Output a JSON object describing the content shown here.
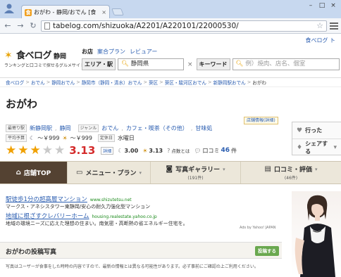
{
  "browser": {
    "tab_title": "おがわ - 静岡/おでん [食",
    "tab_close": "×",
    "url": "tabelog.com/shizuoka/A2201/A220101/22000530/",
    "window_buttons": [
      "–",
      "□",
      "×"
    ]
  },
  "header": {
    "top_right_link": "食べログ ト",
    "logo_text": "食べログ",
    "logo_region": "静岡",
    "tagline": "ランキングと口コミで探せるグルメサイト",
    "nav": [
      {
        "label": "お店",
        "active": true
      },
      {
        "label": "案合プラン",
        "active": false
      },
      {
        "label": "レビュアー",
        "active": false
      }
    ],
    "area_label": "エリア・駅",
    "area_value": "静岡県",
    "clear_icon": "×",
    "keyword_label": "キーワード",
    "keyword_placeholder": "例）焼肉、店名、個室"
  },
  "breadcrumb": {
    "items": [
      "食べログ",
      "おでん",
      "静岡おでん",
      "静岡市（静岡・清水）おでん",
      "葵区",
      "葵区・駿河区おでん",
      "新静岡駅おでん"
    ],
    "current": "おがわ"
  },
  "restaurant": {
    "name": "おがわ",
    "station_label": "最寄り駅",
    "stations": [
      "新静岡駅",
      "静岡"
    ],
    "genre_label": "ジャンル",
    "genres": [
      "おでん",
      "カフェ・喫茶（その他）",
      "甘味処"
    ],
    "info_badge": "店舗情報(詳細)",
    "price_label": "平均予算",
    "price_dinner": "～￥999",
    "price_lunch": "～￥999",
    "holiday_label": "定休日",
    "holiday": "水曜日",
    "rating": 3.13,
    "rating_stars": 3,
    "rating_text": "3.13",
    "detail_label": "詳細",
    "night_score": "3.00",
    "lunch_score": "3.13",
    "points_label": "点数とは",
    "review_label": "口コミ",
    "review_count": "46",
    "review_unit": "件"
  },
  "actions": {
    "went": "行った",
    "share": "シェアする"
  },
  "tabs": [
    {
      "label": "店舗TOP",
      "sub": "",
      "icon": "home-icon",
      "active": true
    },
    {
      "label": "メニュー・プラン",
      "sub": "",
      "icon": "book-icon",
      "active": false
    },
    {
      "label": "写真ギャラリー",
      "sub": "(191件)",
      "icon": "camera-icon",
      "active": false
    },
    {
      "label": "口コミ・評価",
      "sub": "(46件)",
      "icon": "chat-icon",
      "active": false
    }
  ],
  "ads": [
    {
      "title": "駅徒歩1分の超高層マンション",
      "url": "www.shizutetsu.net",
      "desc": "マークス・アネシスタワー東静岡/安心の耐久力強化型マンション"
    },
    {
      "title": "地域に根ざすクレバリーホーム",
      "url": "housing.realestate.yahoo.co.jp",
      "desc": "地域の環境ニーズに応えた理想の住まい。南気密・高断熱の省エネルギー住宅を。"
    }
  ],
  "ads_by": "Ads by Yahoo! JAPAN",
  "photos": {
    "title": "おがわの投稿写真",
    "post_button": "投稿する",
    "notice": "写真はユーザーが食事をした時時の内容ですので、最新の情報とは異なる可能性があります。必ず事前にご確認の上ご利用ください。"
  }
}
